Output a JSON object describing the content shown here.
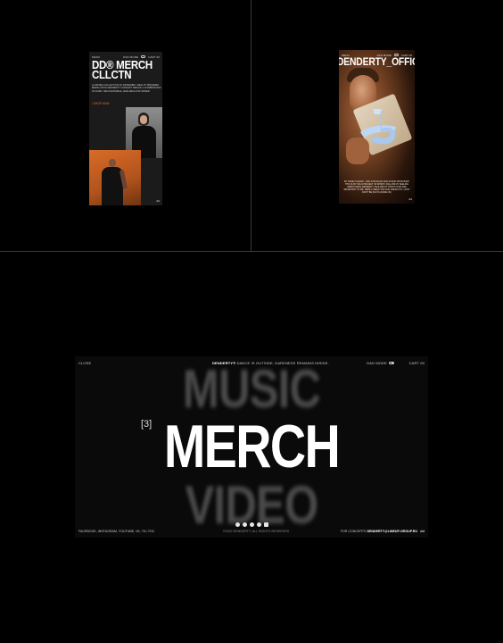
{
  "phone_merch": {
    "menu": "MENU",
    "dad_mode": "DAD MODE",
    "cart": "CART 00",
    "title": "DD® MERCH CLLCTN",
    "description": "A LIMITED COLLECTION OF INCREDIBLY REALITY BRANDED MERCH WITH DENDERTY CONCEPT DESIGN. A COMBINATION OF DARK, RECOGNISABLE. AVAILABLE FOR ORDER.",
    "shop_link": "/ SHOP NOW",
    "logo": "dd"
  },
  "phone_video": {
    "menu": "MENU",
    "dad_mode": "DAD MODE",
    "cart": "CART 00",
    "title": "DENDERTY_OFFIC",
    "description": "MY NAME IS DENIS - AND A MUSICIAN AND SOUND PRODUCER. THIS IS MY SOLO PROJECT. IN WHICH I FOLLOW MY FEELING IMPROVISING DENDERTY TALE ABOUT TOPICS THAT ARE IMPORTANT TO ME. HERE I FREELY MIX AND CREATIVITY. (JUST DON'T BE SUCH A DUDE OK)",
    "logo": "dd"
  },
  "desktop": {
    "close": "CLOSE",
    "brand": "DENDERTY®",
    "tagline": " DANCE IS OUTSIDE, DARKNESS REMAINS INSIDE.",
    "dad_mode": "DAD MODE",
    "cart": "CART 00",
    "menu_prev": "MUSIC",
    "menu_number": "[3]",
    "menu_current": "MERCH",
    "menu_next": "VIDEO",
    "social": "FACEBOOK, INSTAGRAM, YOUTUBE, VK, TIC-TOC",
    "copyright": "©2022 DENDERTY. ALL RIGHTS RESERVED",
    "concerts_label": "FOR CONCERTS ",
    "concerts_email": "DENDERTY@LINEUP-GROUP.RU",
    "logo": "dd"
  },
  "colors": {
    "accent": "#e2702a",
    "background": "#000000",
    "text": "#ffffff"
  },
  "icons": [
    "spotify-icon",
    "apple-music-icon",
    "yandex-music-icon",
    "soundcloud-icon",
    "vk-music-icon"
  ]
}
